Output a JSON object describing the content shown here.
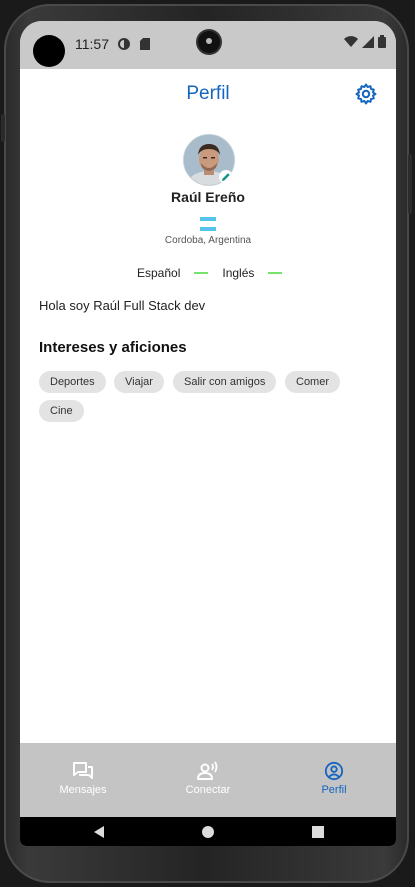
{
  "status_bar": {
    "time": "11:57"
  },
  "app_bar": {
    "title": "Perfil"
  },
  "profile": {
    "name": "Raúl Ereño",
    "location": "Cordoba, Argentina",
    "languages": [
      "Español",
      "Inglés"
    ],
    "bio": "Hola soy Raúl Full Stack dev"
  },
  "interests": {
    "title": "Intereses y aficiones",
    "items": [
      "Deportes",
      "Viajar",
      "Salir con amigos",
      "Comer",
      "Cine"
    ]
  },
  "bottom_nav": {
    "items": [
      {
        "label": "Mensajes",
        "icon": "chat-icon"
      },
      {
        "label": "Conectar",
        "icon": "connect-icon"
      },
      {
        "label": "Perfil",
        "icon": "profile-icon"
      }
    ],
    "active": "Perfil"
  },
  "colors": {
    "accent": "#1565c0",
    "language_level": "#76e36b",
    "nav_background": "#c4c4c4"
  }
}
